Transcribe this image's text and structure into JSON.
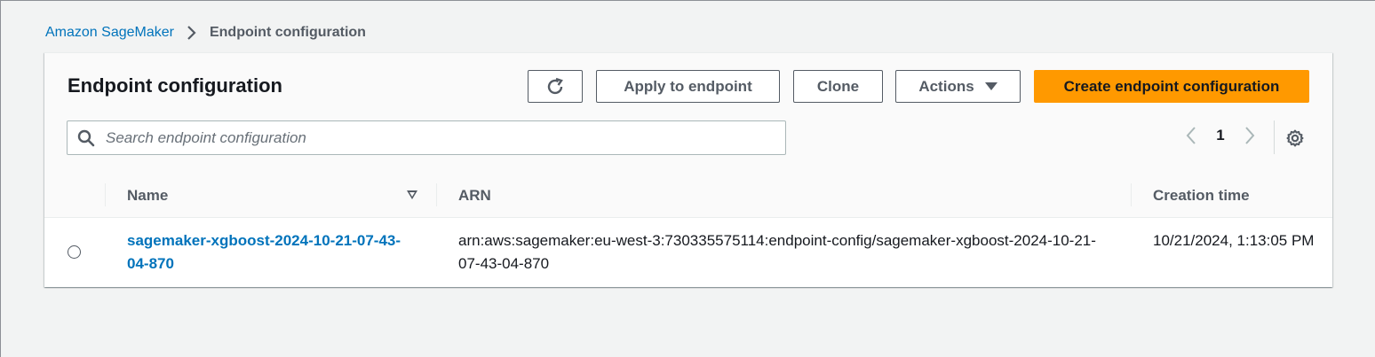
{
  "breadcrumb": {
    "parent": "Amazon SageMaker",
    "current": "Endpoint configuration"
  },
  "panel": {
    "title": "Endpoint configuration",
    "buttons": {
      "refresh_icon": "refresh-icon",
      "apply": "Apply to endpoint",
      "clone": "Clone",
      "actions": "Actions",
      "create": "Create endpoint configuration"
    },
    "search": {
      "placeholder": "Search endpoint configuration",
      "value": ""
    },
    "pagination": {
      "current_page": "1"
    }
  },
  "table": {
    "columns": [
      "Name",
      "ARN",
      "Creation time"
    ],
    "rows": [
      {
        "name": "sagemaker-xgboost-2024-10-21-07-43-04-870",
        "arn": "arn:aws:sagemaker:eu-west-3:730335575114:endpoint-config/sagemaker-xgboost-2024-10-21-07-43-04-870",
        "creation_time": "10/21/2024, 1:13:05 PM"
      }
    ]
  },
  "colors": {
    "link": "#0073bb",
    "primary_button": "#ff9900",
    "background": "#f2f3f3"
  }
}
